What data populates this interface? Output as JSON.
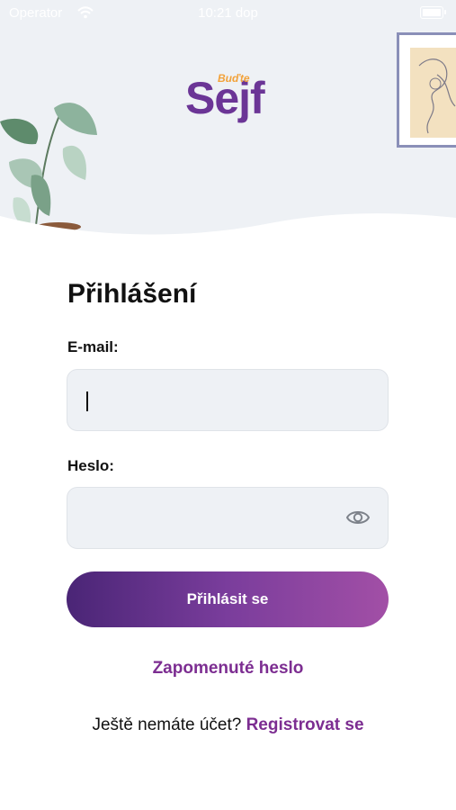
{
  "status_bar": {
    "carrier": "Operator",
    "time": "10:21 dop"
  },
  "brand": {
    "tagline": "Buďte",
    "name": "Sejf",
    "color_primary": "#6b3596",
    "color_accent": "#f2a23a"
  },
  "login": {
    "title": "Přihlášení",
    "email_label": "E-mail:",
    "email_value": "",
    "password_label": "Heslo:",
    "password_value": "",
    "show_password_icon": "eye-icon",
    "submit_label": "Přihlásit se",
    "forgot_password": "Zapomenuté heslo",
    "no_account_text": "Ještě nemáte účet?",
    "register_link": "Registrovat se"
  }
}
